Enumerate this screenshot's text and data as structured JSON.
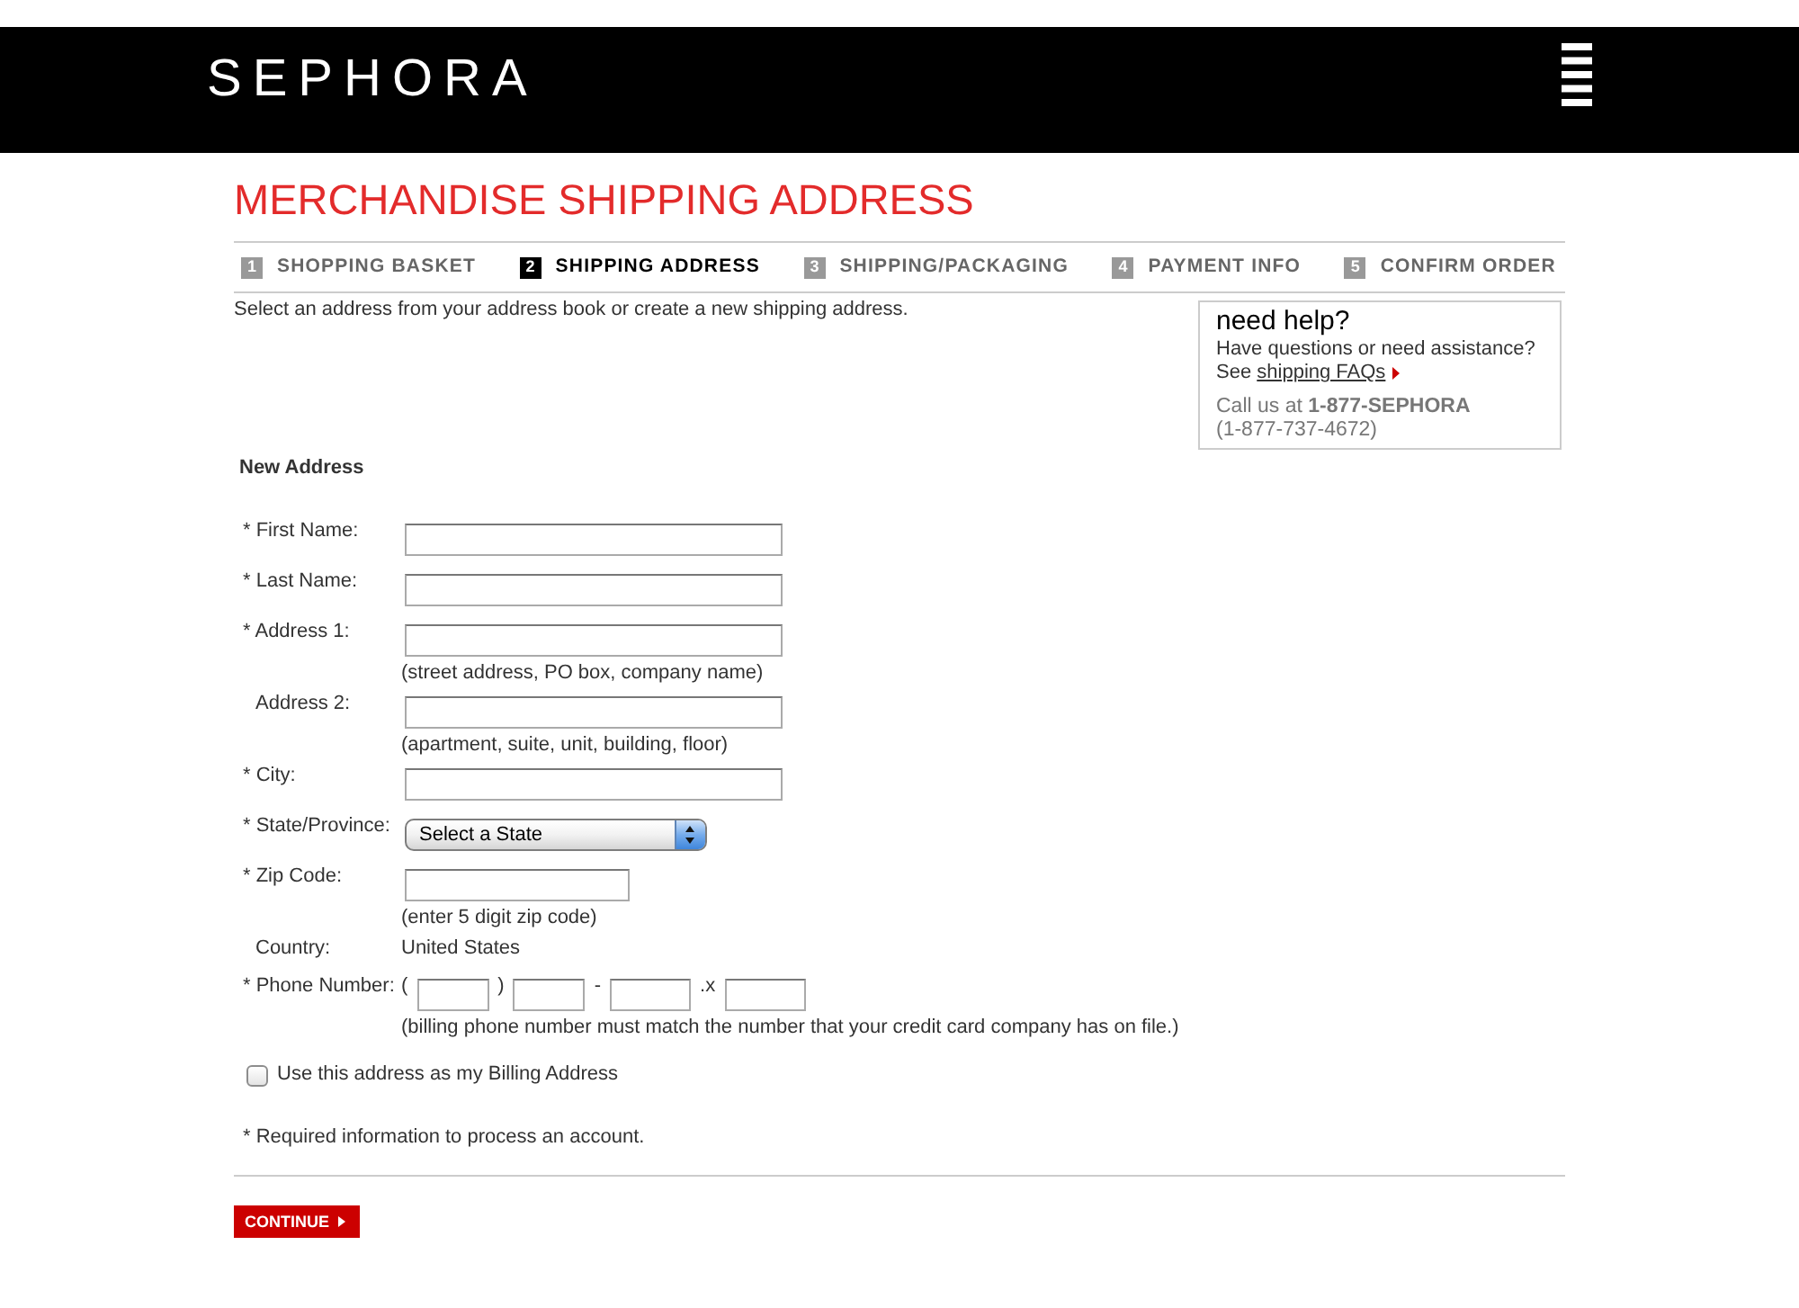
{
  "header": {
    "logo": "SEPHORA"
  },
  "title": "MERCHANDISE SHIPPING ADDRESS",
  "steps": [
    {
      "number": "1",
      "label": "SHOPPING BASKET",
      "selected": false
    },
    {
      "number": "2",
      "label": "SHIPPING ADDRESS",
      "selected": true
    },
    {
      "number": "3",
      "label": "SHIPPING/PACKAGING",
      "selected": false
    },
    {
      "number": "4",
      "label": "PAYMENT INFO",
      "selected": false
    },
    {
      "number": "5",
      "label": "CONFIRM ORDER",
      "selected": false
    }
  ],
  "intro": "Select an address from your address book or create a new shipping address.",
  "help": {
    "title": "need help?",
    "question": "Have questions or need assistance?",
    "faq": {
      "text": "See",
      "link": "shipping FAQs"
    },
    "call": "Call us at **1-877-SEPHORA**",
    "number": "(1-877-737-4672)"
  },
  "form": {
    "heading": "New Address",
    "fields": [
      {
        "kind": "text",
        "marker": "*",
        "label": "First Name:"
      },
      {
        "kind": "text",
        "marker": "*",
        "label": "Last Name:"
      },
      {
        "kind": "text",
        "marker": "*",
        "label": "Address 1:",
        "hint": "(street address, PO box, company name)"
      },
      {
        "kind": "text",
        "label": "Address 2:",
        "hint": "(apartment, suite, unit, building, floor)"
      },
      {
        "kind": "text",
        "marker": "*",
        "label": "City:"
      },
      {
        "kind": "select",
        "marker": "*",
        "label": "State/Province:",
        "value": "Select a State"
      },
      {
        "kind": "short",
        "marker": "*",
        "label": "Zip Code:",
        "hint": "(enter 5 digit zip code)"
      },
      {
        "kind": "static",
        "label": "Country:",
        "value": "United States"
      },
      {
        "kind": "phone",
        "marker": "*",
        "label": "Phone Number:",
        "separators": [
          "(",
          ")",
          "-",
          ".x"
        ],
        "hint": "(billing phone number must match the number that your credit card company has on file.)"
      }
    ]
  },
  "billing_checkbox": {
    "label": "Use this address as my Billing Address",
    "checked": false
  },
  "required_note": "* Required information to process an account.",
  "continue_button": {
    "label": "CONTINUE"
  }
}
